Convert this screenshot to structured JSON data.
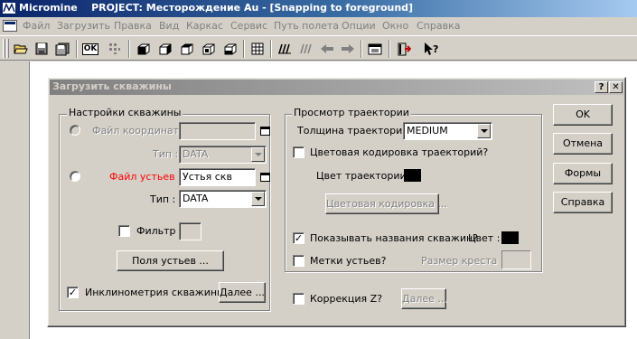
{
  "window": {
    "app_name": "Micromine",
    "project_title": "PROJECT: Месторождение Au - [Snapping to foreground]"
  },
  "menu": {
    "items": [
      "Файл",
      "Загрузить",
      "Правка",
      "Вид",
      "Каркас",
      "Сервис",
      "Путь полета",
      "Опции",
      "Окно",
      "Справка"
    ]
  },
  "toolbar": {
    "ok_label": "OK"
  },
  "dialog": {
    "title": "Загрузить скважины",
    "help_btn": "?",
    "close_btn": "✕",
    "well_settings": {
      "group_label": "Настройки скважины",
      "coord_file_label": "Файл координат :",
      "coord_file_value": "",
      "type_label_1": "Тип :",
      "type_value_1": "DATA",
      "collar_file_label": "Файл устьев :",
      "collar_file_value": "Устья скв",
      "type_label_2": "Тип :",
      "type_value_2": "DATA",
      "filter_label": "Фильтр",
      "filter_value": "",
      "collar_fields_btn": "Поля устьев ...",
      "inclinometry_label": "Инклинометрия скважины?",
      "inclinometry_more_btn": "Далее ..."
    },
    "trace_view": {
      "group_label": "Просмотр траектории",
      "thickness_label": "Толщина траектории :",
      "thickness_value": "MEDIUM",
      "color_coding_label": "Цветовая кодировка траекторий?",
      "trace_color_label": "Цвет траектории :",
      "color_coding_btn": "Цветовая кодировка ...",
      "show_names_label": "Показывать названия скважин?",
      "name_color_label": "Цвет :",
      "collar_marks_label": "Метки устьев?",
      "cross_size_label": "Размер креста :",
      "cross_size_value": ""
    },
    "z_correction_label": "Коррекция Z?",
    "z_more_btn": "Далее ...",
    "buttons": {
      "ok": "OK",
      "cancel": "Отмена",
      "forms": "Формы",
      "help": "Справка"
    },
    "checkbox_states": {
      "filter": false,
      "inclinometry": true,
      "color_coding": false,
      "show_names": true,
      "collar_marks": false,
      "z_correction": false
    },
    "check_mark": "✓",
    "colors": {
      "trace_color": "#000000",
      "name_color": "#000000"
    }
  },
  "colors": {
    "titlebar_active": "#0a246a",
    "dialog_titlebar_inactive": "#808080",
    "face": "#d4d0c8",
    "collar_label_red": "#ff0000"
  }
}
